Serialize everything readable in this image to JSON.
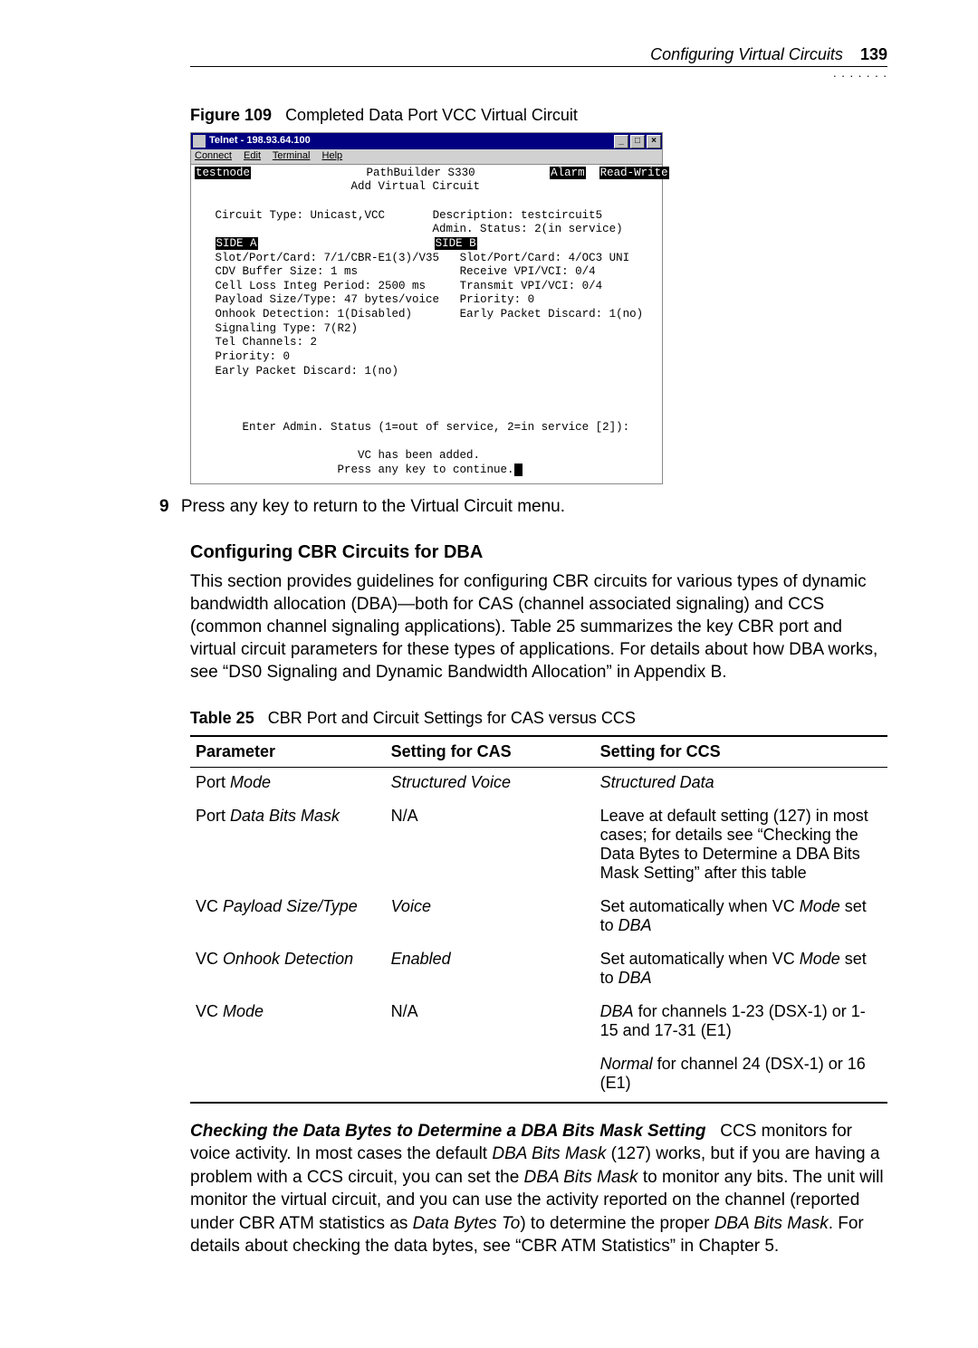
{
  "header": {
    "title": "Configuring Virtual Circuits",
    "page": "139"
  },
  "figure": {
    "label": "Figure 109",
    "caption": "Completed Data Port VCC Virtual Circuit"
  },
  "telnet": {
    "window_title": "Telnet - 198.93.64.100",
    "menu": {
      "connect": "Connect",
      "edit": "Edit",
      "terminal": "Terminal",
      "help": "Help"
    },
    "hostname": "testnode",
    "device": "PathBuilder S330",
    "alarm": "Alarm",
    "rw": "Read-Write",
    "screen_title": "Add Virtual Circuit",
    "circuit_type": "Circuit Type: Unicast,VCC",
    "description": "Description: testcircuit5",
    "admin_status": "Admin. Status: 2(in service)",
    "side_a": "SIDE A",
    "side_b": "SIDE B",
    "a_slot": "Slot/Port/Card: 7/1/CBR-E1(3)/V35",
    "b_slot": "Slot/Port/Card: 4/OC3 UNI",
    "a_cdv": "CDV Buffer Size: 1 ms",
    "b_rx": "Receive VPI/VCI: 0/4",
    "a_cell": "Cell Loss Integ Period: 2500 ms",
    "b_tx": "Transmit VPI/VCI: 0/4",
    "a_payload": "Payload Size/Type: 47 bytes/voice",
    "b_priority": "Priority: 0",
    "a_onhook": "Onhook Detection: 1(Disabled)",
    "b_epd": "Early Packet Discard: 1(no)",
    "a_sig": "Signaling Type: 7(R2)",
    "a_tel": "Tel Channels: 2",
    "a_priority": "Priority: 0",
    "a_epd": "Early Packet Discard: 1(no)",
    "prompt": "Enter Admin. Status (1=out of service, 2=in service [2]):",
    "added": "VC has been added.",
    "press": "Press any key to continue."
  },
  "step9": {
    "num": "9",
    "text": "Press any key to return to the Virtual Circuit menu."
  },
  "section1": {
    "heading": "Configuring CBR Circuits for DBA",
    "para": "This section provides guidelines for configuring CBR circuits for various types of dynamic bandwidth allocation (DBA)—both for CAS (channel associated signaling) and CCS (common channel signaling applications). Table 25 summarizes the key CBR port and virtual circuit parameters for these types of applications. For details about how DBA works, see “DS0 Signaling and Dynamic Bandwidth Allocation” in Appendix B."
  },
  "table": {
    "label": "Table 25",
    "caption": "CBR Port and Circuit Settings for CAS versus CCS",
    "headers": {
      "c1": "Parameter",
      "c2": "Setting for CAS",
      "c3": "Setting for CCS"
    },
    "rows": [
      {
        "p": "Port Mode",
        "cas": "Structured Voice",
        "ccs": "Structured Data",
        "ital": true
      },
      {
        "p": "Port Data Bits Mask",
        "cas": "N/A",
        "ccs": "Leave at default setting (127) in most cases; for details see “Checking the Data Bytes to Determine a DBA Bits Mask Setting” after this table"
      },
      {
        "p": "VC Payload Size/Type",
        "cas": "Voice",
        "ccs_html": "Set automatically when VC <i>Mode</i> set to <i>DBA</i>"
      },
      {
        "p": "VC Onhook Detection",
        "cas": "Enabled",
        "ccs_html": "Set automatically when VC <i>Mode</i> set to <i>DBA</i>"
      },
      {
        "p": "VC Mode",
        "cas": "N/A",
        "ccs_html": "<i>DBA</i> for channels 1-23 (DSX-1) or 1-15 and 17-31 (E1)"
      },
      {
        "p": "",
        "cas": "",
        "ccs_html": "<i>Normal</i> for channel 24 (DSX-1) or 16 (E1)"
      }
    ]
  },
  "section2": {
    "lead": "Checking the Data Bytes to Determine a DBA Bits Mask Setting",
    "rest_html": "&nbsp;&nbsp;&nbsp;CCS monitors for voice activity. In most cases the default <i>DBA Bits Mask</i> (127) works, but if you are having a problem with a CCS circuit, you can set the <i>DBA Bits Mask</i> to monitor any bits. The unit will monitor the virtual circuit, and you can use the activity reported on the channel (reported under CBR ATM statistics as <i>Data Bytes To</i>) to determine the proper <i>DBA Bits Mask</i>. For details about checking the data bytes, see “CBR ATM Statistics” in Chapter 5."
  }
}
